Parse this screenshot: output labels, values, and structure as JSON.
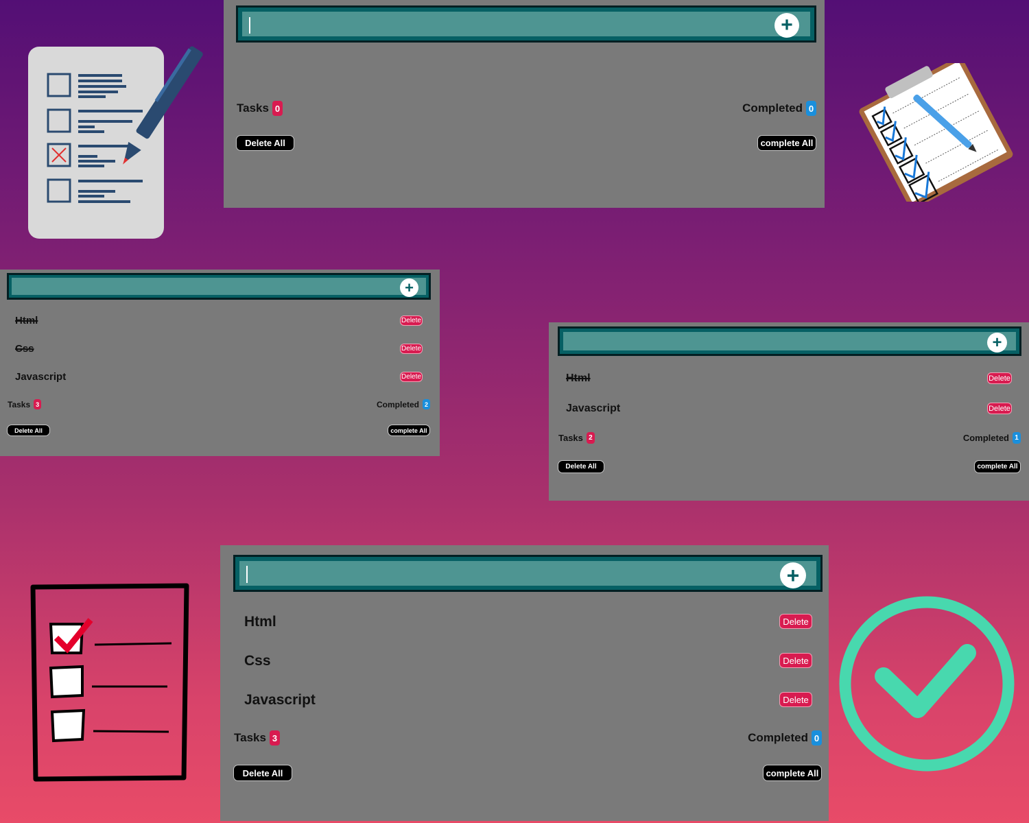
{
  "colors": {
    "panel": "#7a7a7a",
    "bar_outer": "#066064",
    "bar_inner": "#4e9592",
    "delete_red": "#d81b50",
    "completed_blue": "#1a8fdc",
    "check_teal": "#48d8ae"
  },
  "icons": {
    "add": "plus-icon",
    "doc": "checklist-document-icon",
    "clip": "clipboard-checklist-icon",
    "list": "checklist-icon",
    "check": "check-circle-icon"
  },
  "panel1": {
    "add_symbol": "+",
    "tasks": [],
    "tasks_label": "Tasks",
    "tasks_count": "0",
    "completed_label": "Completed",
    "completed_count": "0",
    "delete_all": "Delete All",
    "complete_all": "complete All"
  },
  "panel2": {
    "add_symbol": "+",
    "tasks": [
      {
        "name": "Html",
        "done": true,
        "delete": "Delete"
      },
      {
        "name": "Css",
        "done": true,
        "delete": "Delete"
      },
      {
        "name": "Javascript",
        "done": false,
        "delete": "Delete"
      }
    ],
    "tasks_label": "Tasks",
    "tasks_count": "3",
    "completed_label": "Completed",
    "completed_count": "2",
    "delete_all": "Delete All",
    "complete_all": "complete All"
  },
  "panel3": {
    "add_symbol": "+",
    "tasks": [
      {
        "name": "Html",
        "done": true,
        "delete": "Delete"
      },
      {
        "name": "Javascript",
        "done": false,
        "delete": "Delete"
      }
    ],
    "tasks_label": "Tasks",
    "tasks_count": "2",
    "completed_label": "Completed",
    "completed_count": "1",
    "delete_all": "Delete All",
    "complete_all": "complete All"
  },
  "panel4": {
    "add_symbol": "+",
    "tasks": [
      {
        "name": "Html",
        "done": false,
        "delete": "Delete"
      },
      {
        "name": "Css",
        "done": false,
        "delete": "Delete"
      },
      {
        "name": "Javascript",
        "done": false,
        "delete": "Delete"
      }
    ],
    "tasks_label": "Tasks",
    "tasks_count": "3",
    "completed_label": "Completed",
    "completed_count": "0",
    "delete_all": "Delete All",
    "complete_all": "complete All"
  }
}
